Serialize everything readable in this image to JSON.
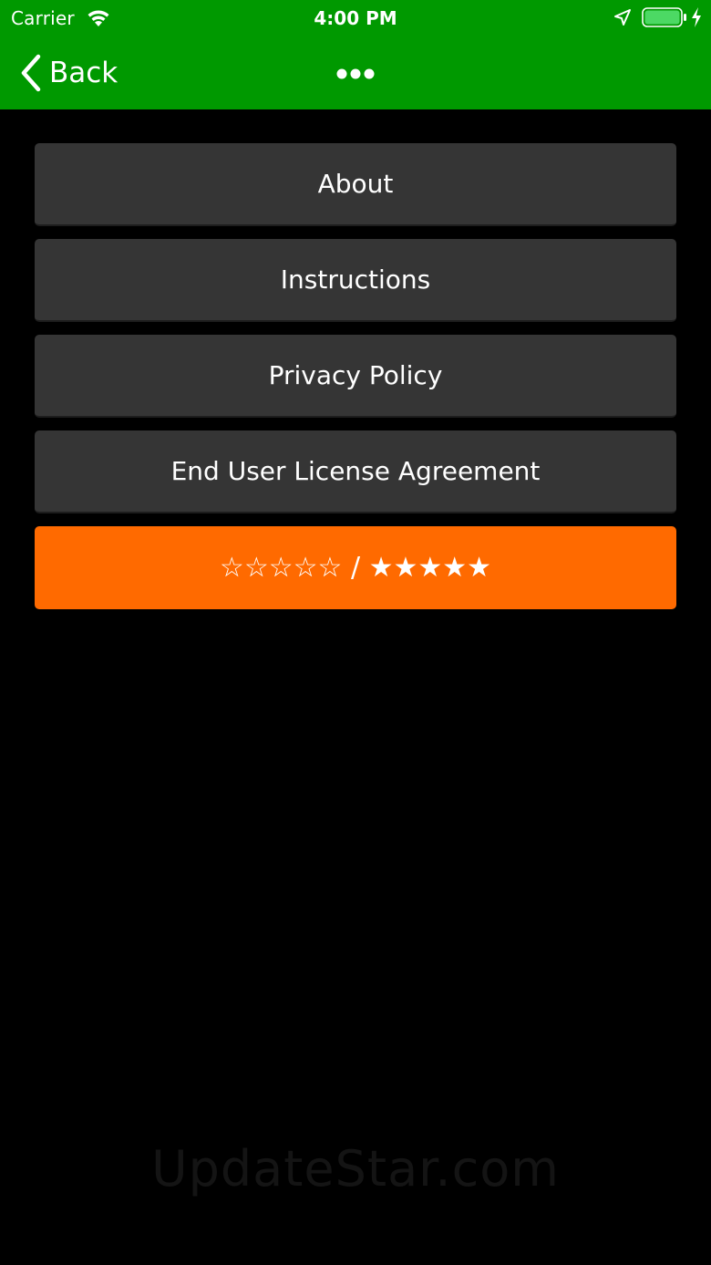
{
  "status_bar": {
    "carrier": "Carrier",
    "time": "4:00 PM",
    "icons": [
      "wifi-icon",
      "location-arrow-icon",
      "battery-icon",
      "charging-bolt-icon"
    ]
  },
  "nav": {
    "back_label": "Back",
    "back_icon": "chevron-left-icon",
    "more_icon": "ellipsis-icon"
  },
  "menu": {
    "items": [
      {
        "label": "About"
      },
      {
        "label": "Instructions"
      },
      {
        "label": "Privacy Policy"
      },
      {
        "label": "End User License Agreement"
      }
    ],
    "rate": {
      "empty_stars": "☆☆☆☆☆",
      "separator": " / ",
      "filled_stars": "★★★★★"
    }
  },
  "watermark": "UpdateStar.com",
  "colors": {
    "nav_background": "#009900",
    "button_background": "#353535",
    "rate_background": "#ff6a00",
    "page_background": "#000000",
    "battery_fill": "#4cd964"
  }
}
